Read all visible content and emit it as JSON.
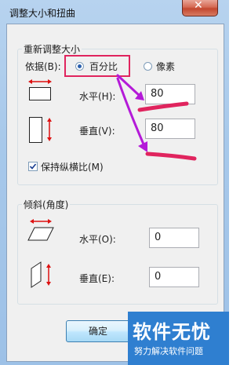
{
  "window": {
    "title": "调整大小和扭曲",
    "close_glyph": "✕"
  },
  "resize": {
    "group_label": "重新调整大小",
    "by_label": "依据(B):",
    "options": [
      {
        "label": "百分比",
        "selected": true
      },
      {
        "label": "像素",
        "selected": false
      }
    ],
    "horizontal_label": "水平(H):",
    "horizontal_value": "80",
    "vertical_label": "垂直(V):",
    "vertical_value": "80",
    "keep_ratio_label": "保持纵横比(M)",
    "keep_ratio_checked": true
  },
  "skew": {
    "group_label": "倾斜(角度)",
    "horizontal_label": "水平(O):",
    "horizontal_value": "0",
    "vertical_label": "垂直(E):",
    "vertical_value": "0"
  },
  "buttons": {
    "ok_label": "确定"
  },
  "watermark": {
    "title": "软件无忧",
    "subtitle": "努力解决软件问题"
  },
  "colors": {
    "annotation": "#e0245e",
    "arrow_accent": "#b41ad8",
    "watermark_bg": "#2f7fd0"
  }
}
